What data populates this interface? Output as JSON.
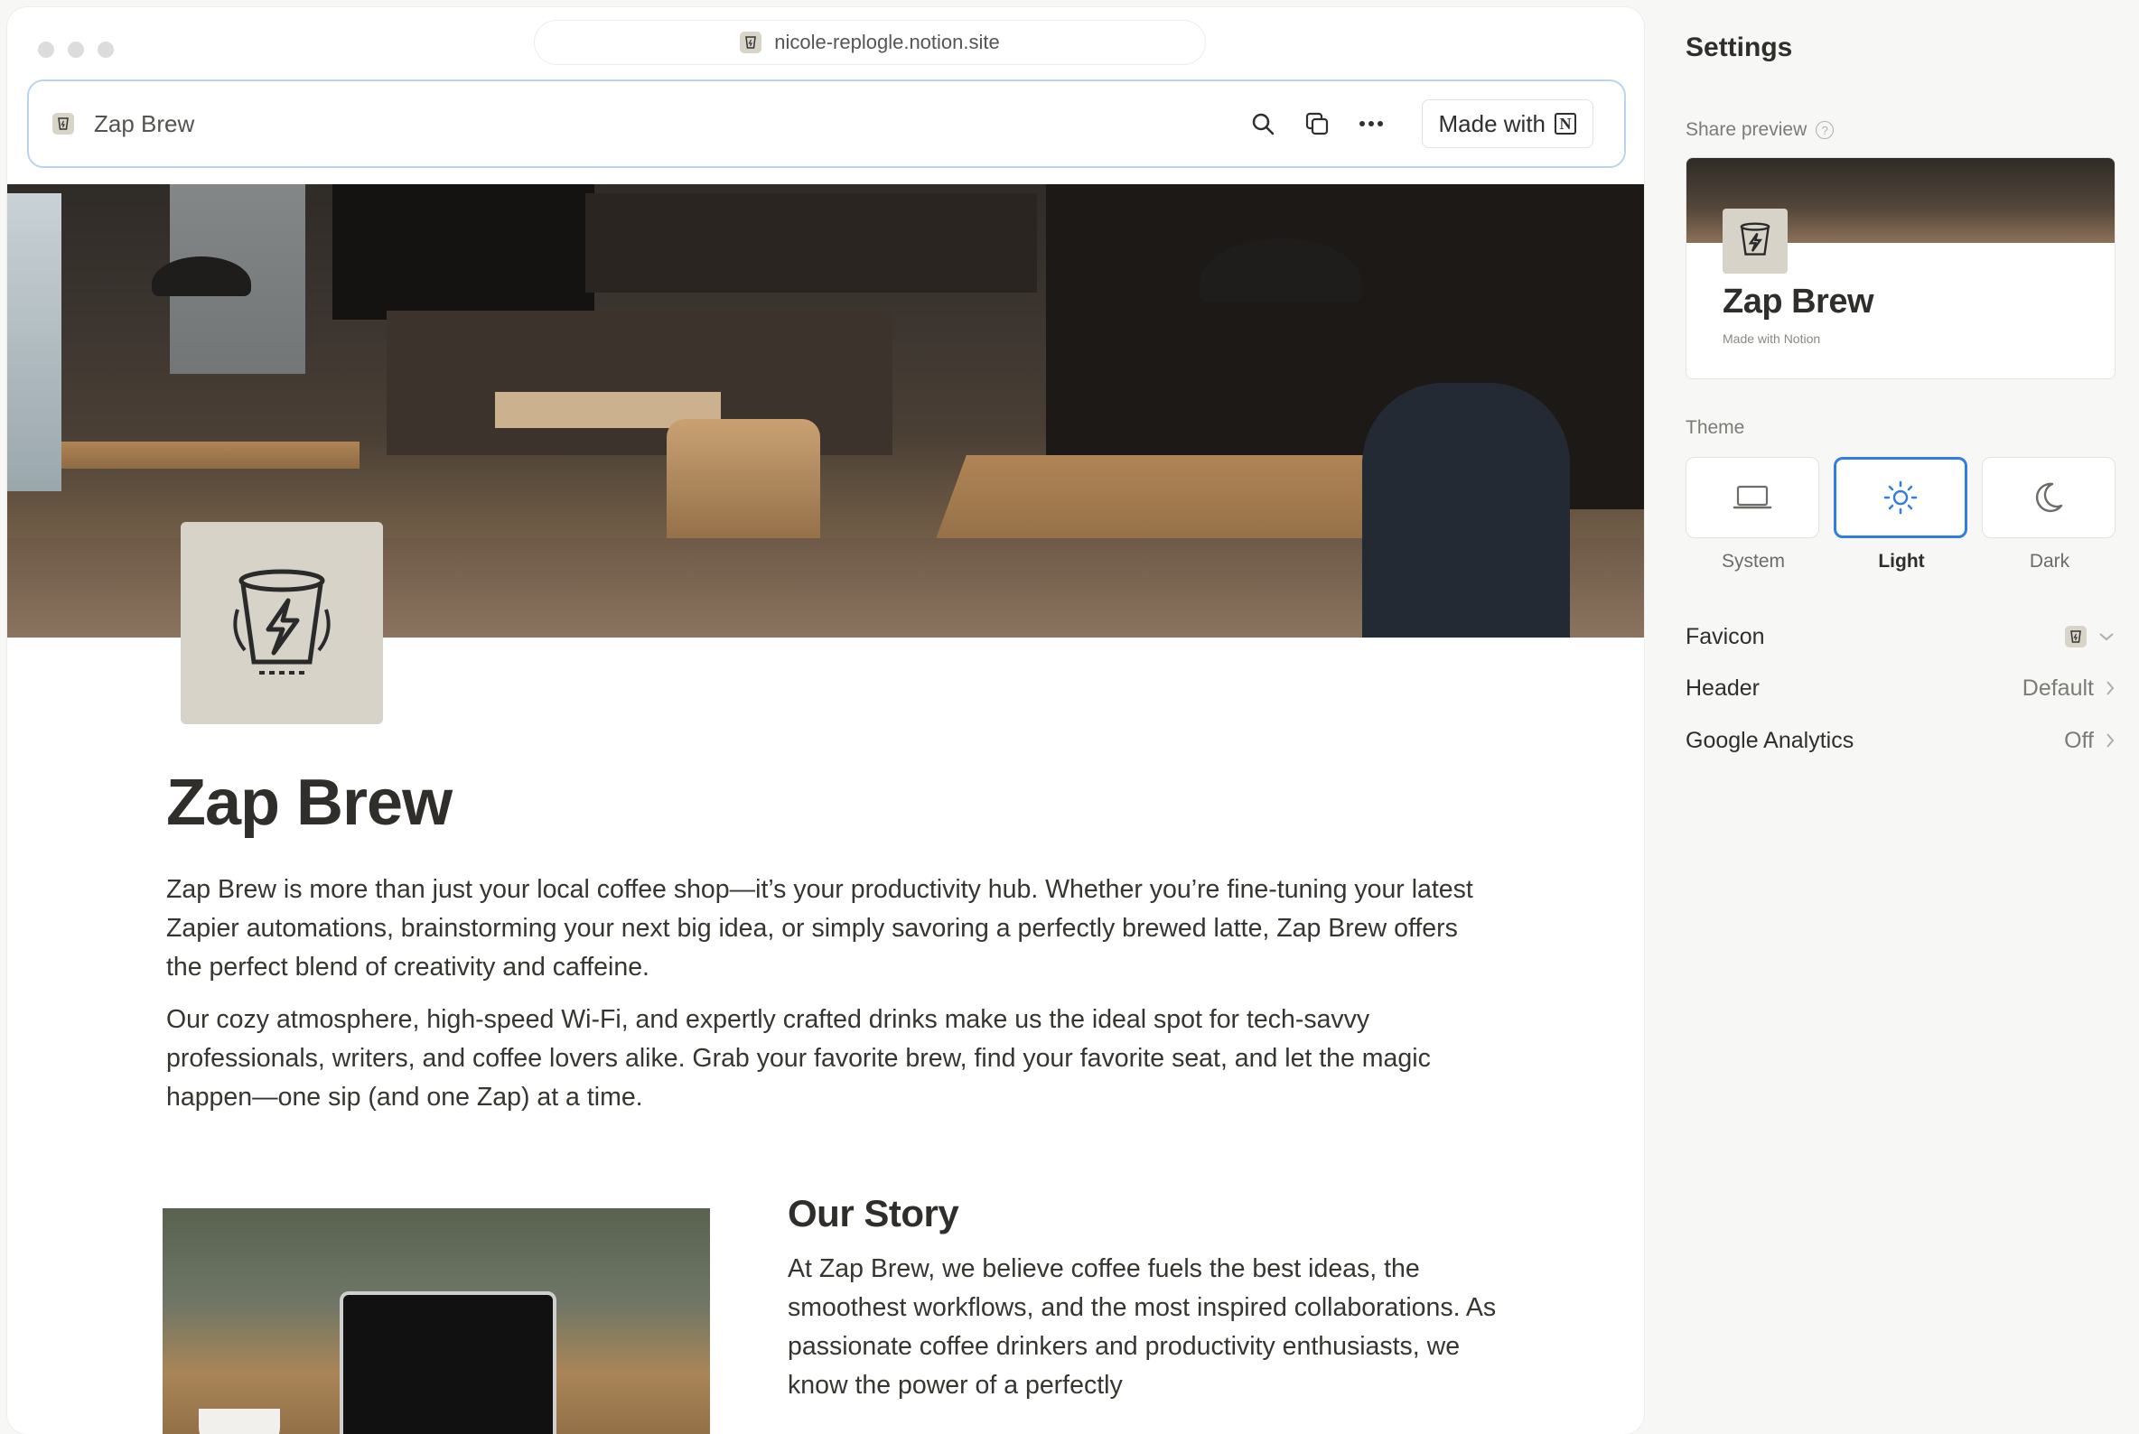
{
  "browser": {
    "url": "nicole-replogle.notion.site"
  },
  "topbar": {
    "site_title": "Zap Brew",
    "made_with_label": "Made with",
    "made_with_logo": "N"
  },
  "page": {
    "title": "Zap Brew",
    "paragraphs": [
      "Zap Brew is more than just your local coffee shop—it’s your productivity hub. Whether you’re fine-tuning your latest Zapier automations, brainstorming your next big idea, or simply savoring a perfectly brewed latte, Zap Brew offers the perfect blend of creativity and caffeine.",
      "Our cozy atmosphere, high-speed Wi-Fi, and expertly crafted drinks make us the ideal spot for tech-savvy professionals, writers, and coffee lovers alike. Grab your favorite brew, find your favorite seat, and let the magic happen—one sip (and one Zap) at a time."
    ],
    "story": {
      "heading": "Our Story",
      "text": "At Zap Brew, we believe coffee fuels the best ideas, the smoothest workflows, and the most inspired collaborations. As passionate coffee drinkers and productivity enthusiasts, we know the power of a perfectly"
    }
  },
  "settings": {
    "title": "Settings",
    "share_preview_label": "Share preview",
    "share_preview": {
      "title": "Zap Brew",
      "subtitle": "Made with Notion"
    },
    "theme_label": "Theme",
    "themes": [
      {
        "label": "System",
        "icon": "laptop-icon",
        "active": false
      },
      {
        "label": "Light",
        "icon": "sun-icon",
        "active": true
      },
      {
        "label": "Dark",
        "icon": "moon-icon",
        "active": false
      }
    ],
    "rows": [
      {
        "label": "Favicon",
        "value": ""
      },
      {
        "label": "Header",
        "value": "Default"
      },
      {
        "label": "Google Analytics",
        "value": "Off"
      }
    ]
  },
  "colors": {
    "accent": "#2f7fe0",
    "topbar_border": "#bcd3f0",
    "icon_bg": "#d7d3c8"
  }
}
